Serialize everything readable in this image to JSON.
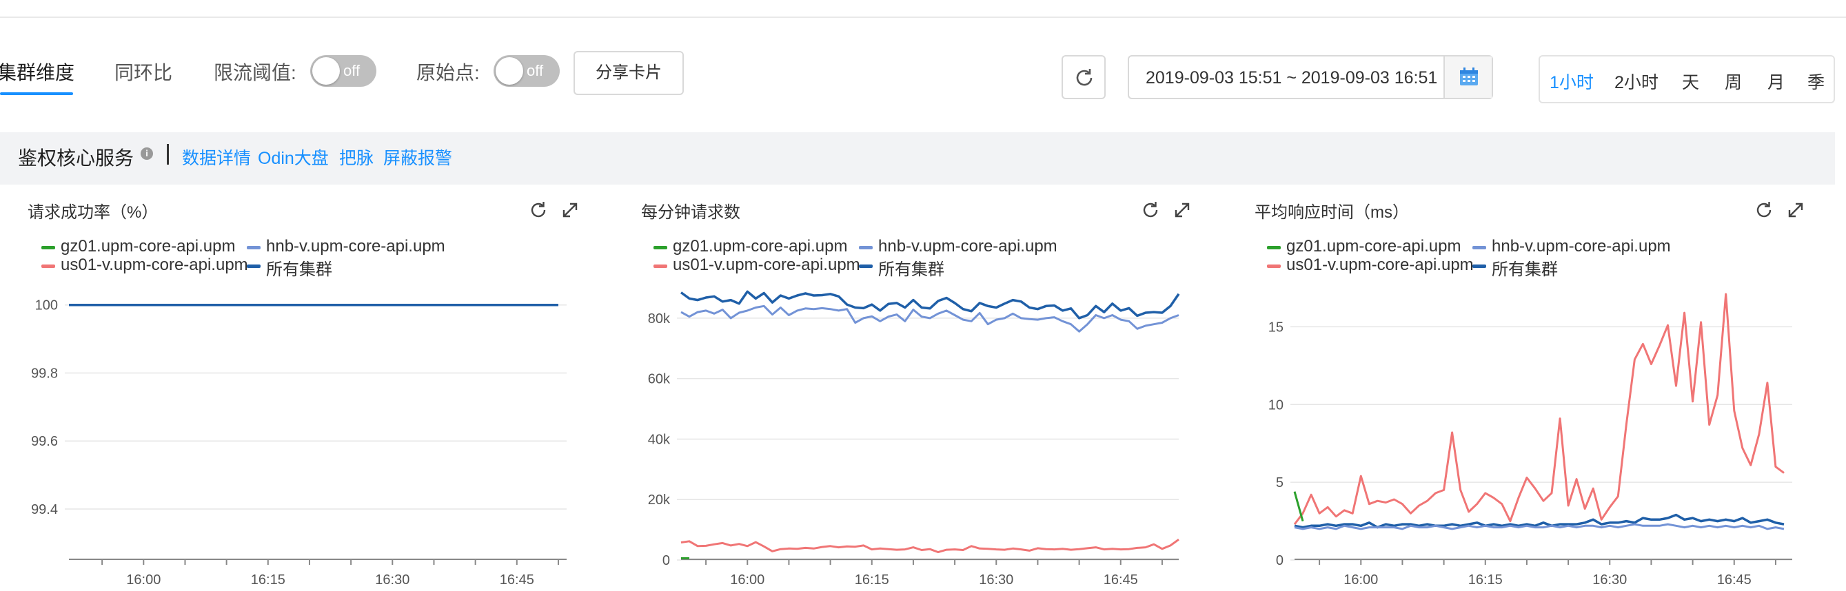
{
  "toolbar": {
    "tabs": [
      {
        "label": "集群维度",
        "active": true
      },
      {
        "label": "同环比",
        "active": false
      }
    ],
    "rate_limit_label": "限流阈值:",
    "rate_limit_switch": "off",
    "raw_point_label": "原始点:",
    "raw_point_switch": "off",
    "share_button": "分享卡片",
    "time_range": "2019-09-03 15:51 ~ 2019-09-03 16:51",
    "periods": [
      "1小时",
      "2小时",
      "天",
      "周",
      "月",
      "季"
    ],
    "active_period": "1小时",
    "accent_color": "#1890ff"
  },
  "service": {
    "title": "鉴权核心服务",
    "links": [
      "数据详情",
      "Odin大盘",
      "把脉",
      "屏蔽报警"
    ]
  },
  "legend": [
    {
      "name": "gz01.upm-core-api.upm",
      "color": "#2ca02c"
    },
    {
      "name": "hnb-v.upm-core-api.upm",
      "color": "#7393d6"
    },
    {
      "name": "us01-v.upm-core-api.upm",
      "color": "#f07575"
    },
    {
      "name": "所有集群",
      "color": "#1f5fa8"
    }
  ],
  "panels": [
    {
      "title": "请求成功率（%）"
    },
    {
      "title": "每分钟请求数"
    },
    {
      "title": "平均响应时间（ms）"
    }
  ],
  "chart_data": [
    {
      "type": "line",
      "title": "请求成功率（%）",
      "x_ticks": [
        "16:00",
        "16:15",
        "16:30",
        "16:45"
      ],
      "y_ticks": [
        "100",
        "99.8",
        "99.6",
        "99.4"
      ],
      "ylim": [
        99.25,
        100.05
      ],
      "x_range_min": [
        -9,
        51
      ],
      "series": [
        {
          "name": "所有集群",
          "color": "#1f5fa8",
          "x": [
            -9,
            50
          ],
          "values": [
            100,
            100
          ]
        }
      ]
    },
    {
      "type": "line",
      "title": "每分钟请求数",
      "x_ticks": [
        "16:00",
        "16:15",
        "16:30",
        "16:45"
      ],
      "y_ticks": [
        "80k",
        "60k",
        "40k",
        "20k",
        "0"
      ],
      "ylim": [
        0,
        90000
      ],
      "x_range_min": [
        -8,
        52
      ],
      "series": [
        {
          "name": "所有集群",
          "color": "#1f5fa8",
          "x_start": -8,
          "values": [
            88500,
            86500,
            86000,
            86800,
            87200,
            85500,
            86000,
            84800,
            88800,
            86500,
            88300,
            85200,
            87500,
            86500,
            87500,
            88200,
            87500,
            87600,
            88000,
            87200,
            84500,
            83500,
            83300,
            84500,
            82500,
            84700,
            85000,
            83500,
            86000,
            83500,
            83200,
            85700,
            86700,
            85000,
            83000,
            82300,
            85000,
            84000,
            83500,
            84800,
            86000,
            85500,
            83500,
            83000,
            84000,
            84200,
            82500,
            83200,
            80000,
            81000,
            84000,
            82000,
            84800,
            82500,
            83300,
            80800,
            81800,
            82000,
            81800,
            84000,
            88000
          ]
        },
        {
          "name": "hnb-v.upm-core-api.upm",
          "color": "#7393d6",
          "x_start": -8,
          "values": [
            82000,
            80500,
            82000,
            82500,
            81500,
            82800,
            80000,
            81800,
            82500,
            83500,
            84000,
            81200,
            83500,
            81000,
            82500,
            83200,
            83000,
            83300,
            83000,
            82500,
            83000,
            78500,
            80000,
            80600,
            79000,
            80500,
            81200,
            79000,
            82800,
            80500,
            80000,
            81500,
            82500,
            81000,
            79500,
            79000,
            81700,
            78000,
            79500,
            80000,
            81500,
            80000,
            79700,
            79500,
            80000,
            80300,
            79000,
            78000,
            75600,
            78000,
            81000,
            80000,
            81000,
            79500,
            79000,
            76500,
            77500,
            78000,
            78500,
            80000,
            81000
          ]
        },
        {
          "name": "us01-v.upm-core-api.upm",
          "color": "#f07575",
          "x_start": -8,
          "values": [
            5800,
            6200,
            4600,
            4700,
            5200,
            5600,
            4800,
            5300,
            4600,
            5900,
            4500,
            2900,
            3600,
            3800,
            3700,
            4000,
            3800,
            4300,
            4600,
            4200,
            4500,
            4400,
            4800,
            3500,
            3800,
            3600,
            3400,
            3500,
            4200,
            3300,
            3600,
            2600,
            3400,
            3500,
            3300,
            4600,
            3800,
            3700,
            3500,
            3400,
            3800,
            3500,
            3100,
            3900,
            3600,
            3500,
            3700,
            3400,
            3600,
            3900,
            4200,
            3500,
            3700,
            3500,
            3600,
            4000,
            4200,
            5200,
            3700,
            4800,
            6800
          ]
        },
        {
          "name": "gz01.upm-core-api.upm",
          "color": "#2ca02c",
          "x_start": -8,
          "values": [
            600,
            600
          ]
        }
      ]
    },
    {
      "type": "line",
      "title": "平均响应时间（ms）",
      "x_ticks": [
        "16:00",
        "16:15",
        "16:30",
        "16:45"
      ],
      "y_ticks": [
        "15",
        "10",
        "5",
        "0"
      ],
      "ylim": [
        0,
        17.5
      ],
      "x_range_min": [
        -8,
        52
      ],
      "series": [
        {
          "name": "us01-v.upm-core-api.upm",
          "color": "#f07575",
          "x_start": -8,
          "values": [
            2.3,
            3,
            4.2,
            3,
            3.4,
            2.8,
            3.2,
            3,
            5.4,
            3.6,
            3.8,
            3.7,
            3.9,
            3.6,
            3,
            3.5,
            3.8,
            4.3,
            4.5,
            8.2,
            4.5,
            3.1,
            3.6,
            4.3,
            4,
            3.6,
            2.5,
            4,
            5.3,
            4.6,
            3.8,
            4.3,
            9.1,
            3.5,
            5.2,
            3.3,
            4.6,
            2.6,
            3.4,
            4.1,
            8.7,
            12.9,
            13.9,
            12.6,
            13.8,
            15.1,
            11.2,
            15.9,
            10.2,
            15.3,
            8.7,
            10.6,
            17.1,
            9.6,
            7.2,
            6.1,
            8.1,
            11.4,
            6,
            5.6
          ]
        },
        {
          "name": "所有集群",
          "color": "#1f5fa8",
          "x_start": -8,
          "values": [
            2.2,
            2.1,
            2.2,
            2.2,
            2.3,
            2.2,
            2.3,
            2.3,
            2.2,
            2.4,
            2.1,
            2.3,
            2.2,
            2.3,
            2.3,
            2.2,
            2.3,
            2.2,
            2.2,
            2.3,
            2.2,
            2.3,
            2.4,
            2.2,
            2.3,
            2.2,
            2.3,
            2.2,
            2.3,
            2.2,
            2.4,
            2.2,
            2.3,
            2.3,
            2.3,
            2.4,
            2.6,
            2.3,
            2.4,
            2.4,
            2.5,
            2.4,
            2.7,
            2.6,
            2.6,
            2.7,
            2.9,
            2.6,
            2.7,
            2.5,
            2.6,
            2.5,
            2.6,
            2.5,
            2.7,
            2.4,
            2.5,
            2.6,
            2.4,
            2.3
          ]
        },
        {
          "name": "hnb-v.upm-core-api.upm",
          "color": "#7393d6",
          "x_start": -8,
          "values": [
            2.1,
            2,
            2.1,
            2,
            2.1,
            2,
            2.2,
            2.1,
            2,
            2.1,
            2.1,
            2.1,
            2.1,
            2,
            2.2,
            2.1,
            2.1,
            2.2,
            2.1,
            2,
            2.1,
            2.2,
            2.1,
            2.2,
            2.1,
            2.1,
            2.2,
            2.1,
            2.2,
            2.1,
            2.1,
            2.2,
            2.1,
            2.2,
            2.1,
            2.2,
            2.2,
            2.1,
            2.2,
            2.1,
            2.2,
            2.3,
            2.2,
            2.2,
            2.2,
            2.3,
            2.2,
            2.1,
            2.2,
            2.1,
            2.2,
            2.1,
            2.2,
            2.1,
            2.2,
            2.1,
            2.2,
            2,
            2.1,
            2
          ]
        },
        {
          "name": "gz01.upm-core-api.upm",
          "color": "#2ca02c",
          "x_start": -8,
          "values": [
            4.4,
            2.5
          ]
        }
      ]
    }
  ]
}
